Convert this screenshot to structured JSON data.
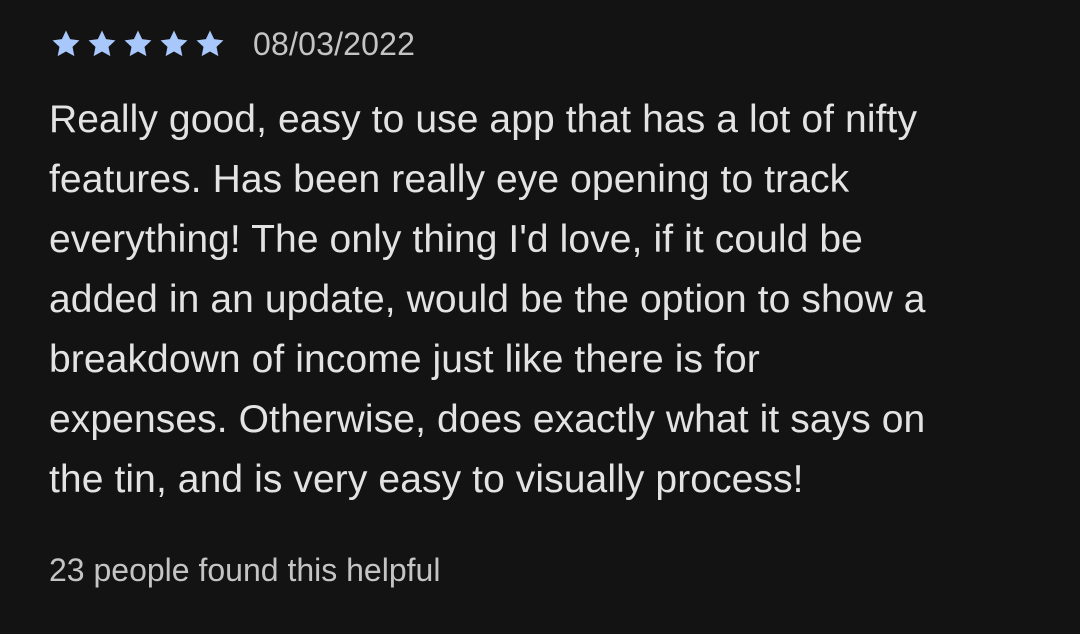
{
  "review": {
    "rating": 5,
    "max_rating": 5,
    "star_color": "#a8c7fa",
    "date": "08/03/2022",
    "text_lines": [
      "Really good, easy to use app that has a lot of nifty",
      "features. Has been really eye opening to track",
      "everything! The only thing I'd love, if it could be",
      "added in an update, would be the option to show a",
      "breakdown of income just like there is for",
      "expenses. Otherwise, does exactly what it says on",
      "the tin, and is very easy to visually process!"
    ],
    "helpful_text": "23 people found this helpful"
  }
}
